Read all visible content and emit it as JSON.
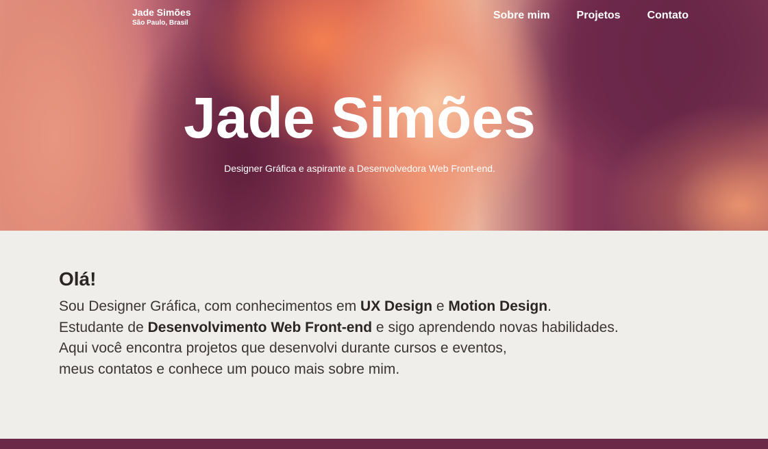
{
  "nav": {
    "brand_name": "Jade Simões",
    "brand_location": "São Paulo, Brasil",
    "links": [
      "Sobre mim",
      "Projetos",
      "Contato"
    ]
  },
  "hero": {
    "title": "Jade Simões",
    "subtitle": "Designer Gráfica e aspirante a Desenvolvedora Web Front-end."
  },
  "intro": {
    "heading": "Olá!",
    "line1_a": "Sou Designer Gráfica, com conhecimentos em ",
    "line1_b": "UX Design",
    "line1_c": " e ",
    "line1_d": "Motion Design",
    "line1_e": ".",
    "line2_a": "Estudante de ",
    "line2_b": "Desenvolvimento Web Front-end",
    "line2_c": " e sigo aprendendo novas habilidades.",
    "line3": "Aqui você encontra projetos que desenvolvi durante cursos e eventos,",
    "line4": "meus contatos e conhece um pouco mais sobre mim."
  },
  "colors": {
    "background": "#efeeea",
    "footer": "#6b2a48",
    "text": "#2a2626"
  }
}
